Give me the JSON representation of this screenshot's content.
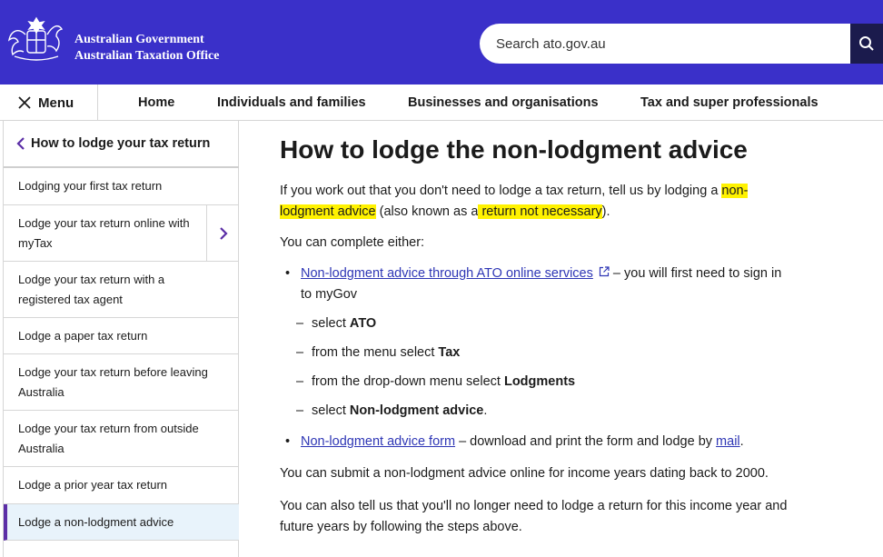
{
  "header": {
    "gov_line1": "Australian Government",
    "gov_line2": "Australian Taxation Office",
    "search_placeholder": "Search ato.gov.au",
    "brand_color": "#3a30c9"
  },
  "nav": {
    "menu_label": "Menu",
    "items": [
      "Home",
      "Individuals and families",
      "Businesses and organisations",
      "Tax and super professionals"
    ]
  },
  "sidebar": {
    "back_label": "How to lodge your tax return",
    "items": [
      "Lodging your first tax return",
      "Lodge your tax return online with myTax",
      "Lodge your tax return with a registered tax agent",
      "Lodge a paper tax return",
      "Lodge your tax return before leaving Australia",
      "Lodge your tax return from outside Australia",
      "Lodge a prior year tax return",
      "Lodge a non-lodgment advice"
    ],
    "active_index": 7
  },
  "main": {
    "title": "How to lodge the non-lodgment advice",
    "intro_a": "If you work out that you don't need to lodge a tax return, tell us by lodging a ",
    "intro_hl1a": "non-",
    "intro_hl1b": "lodgment advice",
    "intro_b": " (also known as a",
    "intro_hl2": " return not necessary",
    "intro_c": ").",
    "complete_either": "You can complete either:",
    "bullet1_link": "Non-lodgment advice through ATO online services",
    "bullet1_rest_a": " – you will first need to sign in",
    "bullet1_rest_b": "to myGov",
    "steps": [
      {
        "pre": "select ",
        "bold": "ATO",
        "post": ""
      },
      {
        "pre": "from the menu select ",
        "bold": "Tax",
        "post": ""
      },
      {
        "pre": "from the drop-down menu select ",
        "bold": "Lodgments",
        "post": ""
      },
      {
        "pre": "select ",
        "bold": "Non-lodgment advice",
        "post": "."
      }
    ],
    "bullet2_link": "Non-lodgment advice form",
    "bullet2_rest": " – download and print the form and lodge by ",
    "bullet2_mail": "mail",
    "bullet2_end": ".",
    "online_para": "You can submit a non-lodgment advice online for income years dating back to 2000.",
    "future_a": "You can also tell us that you'll no longer need to lodge a return for this income year and",
    "future_b": "future years by following the steps above."
  }
}
